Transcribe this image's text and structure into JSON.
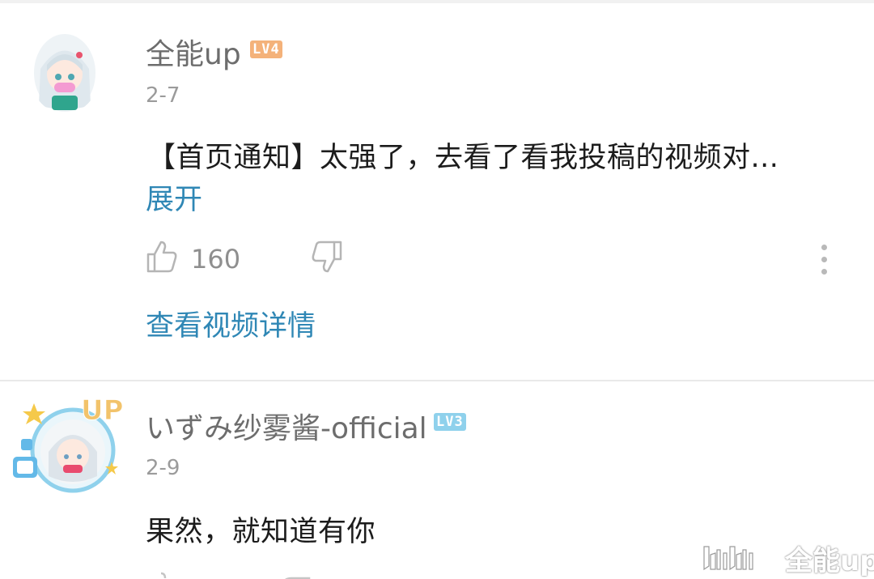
{
  "comments": [
    {
      "username": "全能up",
      "level": "LV4",
      "date": "2-7",
      "content": "【首页通知】太强了，去看了看我投稿的视频对...",
      "expand_label": "展开",
      "like_count": "160",
      "view_video_label": "查看视频详情"
    },
    {
      "username": "いずみ纱雾酱-official",
      "level": "LV3",
      "date": "2-9",
      "content": "果然，就知道有你",
      "avatar_badge": "UP"
    }
  ],
  "watermark": {
    "logo": "bilibili",
    "text": "全能up"
  },
  "colors": {
    "link": "#2f87b5",
    "level4": "#f4b27a",
    "level3": "#8fd1ec",
    "muted": "#9b9b9b"
  },
  "icons": [
    "avatar-anime-girl",
    "thumbs-up-icon",
    "thumbs-down-icon",
    "more-vertical-icon",
    "bilibili-logo"
  ]
}
